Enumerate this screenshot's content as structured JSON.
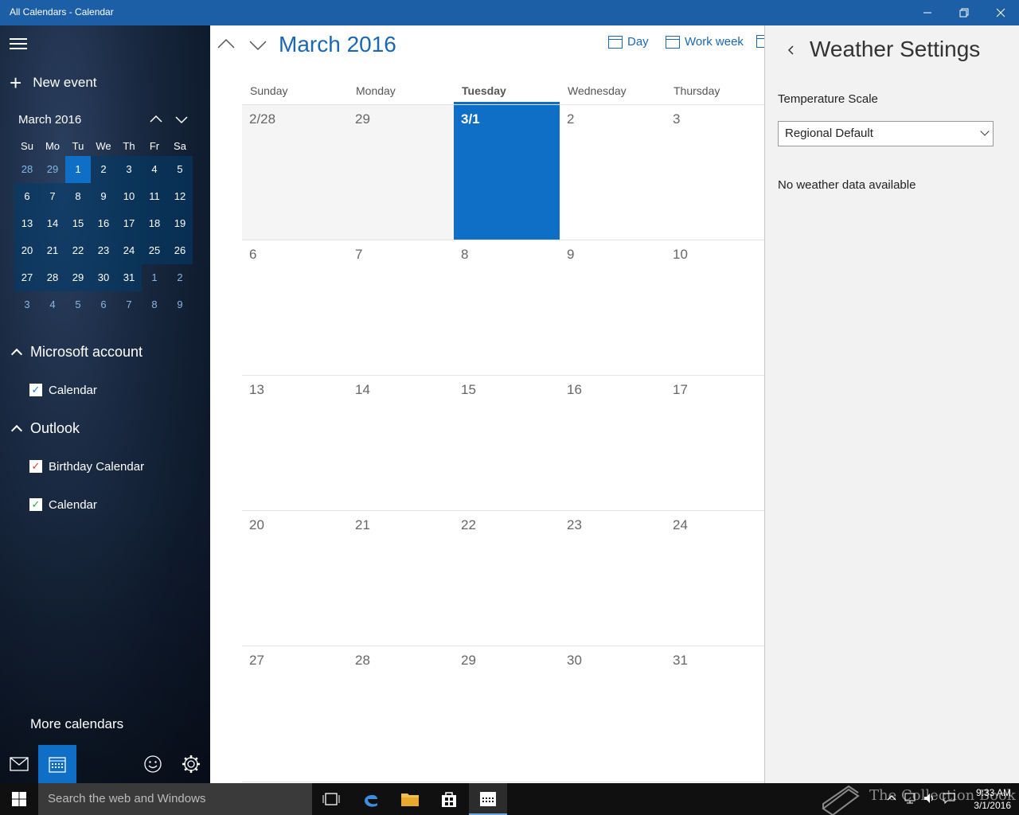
{
  "window": {
    "title": "All Calendars - Calendar"
  },
  "sidebar": {
    "new_event_label": "New event",
    "mini_calendar": {
      "month_label": "March 2016",
      "weekdays": [
        "Su",
        "Mo",
        "Tu",
        "We",
        "Th",
        "Fr",
        "Sa"
      ],
      "weeks": [
        [
          "28",
          "29",
          "1",
          "2",
          "3",
          "4",
          "5"
        ],
        [
          "6",
          "7",
          "8",
          "9",
          "10",
          "11",
          "12"
        ],
        [
          "13",
          "14",
          "15",
          "16",
          "17",
          "18",
          "19"
        ],
        [
          "20",
          "21",
          "22",
          "23",
          "24",
          "25",
          "26"
        ],
        [
          "27",
          "28",
          "29",
          "30",
          "31",
          "1",
          "2"
        ],
        [
          "3",
          "4",
          "5",
          "6",
          "7",
          "8",
          "9"
        ]
      ],
      "selected_day": "1"
    },
    "accounts": [
      {
        "name": "Microsoft account",
        "calendars": [
          {
            "label": "Calendar",
            "checked": true,
            "color": "#1a73d8"
          }
        ]
      },
      {
        "name": "Outlook",
        "calendars": [
          {
            "label": "Birthday Calendar",
            "checked": true,
            "color": "#d83b2b"
          },
          {
            "label": "Calendar",
            "checked": true,
            "color": "#2e9e44"
          }
        ]
      }
    ],
    "more_calendars_label": "More calendars"
  },
  "calendar": {
    "month_title": "March 2016",
    "views": {
      "day": "Day",
      "work_week": "Work week"
    },
    "weekdays": [
      "Sunday",
      "Monday",
      "Tuesday",
      "Wednesday",
      "Thursday"
    ],
    "today_weekday": "Tuesday",
    "weeks": [
      [
        "2/28",
        "29",
        "3/1",
        "2",
        "3"
      ],
      [
        "6",
        "7",
        "8",
        "9",
        "10"
      ],
      [
        "13",
        "14",
        "15",
        "16",
        "17"
      ],
      [
        "20",
        "21",
        "22",
        "23",
        "24"
      ],
      [
        "27",
        "28",
        "29",
        "30",
        "31"
      ]
    ],
    "today_label": "3/1",
    "accent": "#0f6fc6"
  },
  "weather_panel": {
    "title": "Weather Settings",
    "temperature_label": "Temperature Scale",
    "temperature_value": "Regional Default",
    "message": "No weather data available"
  },
  "taskbar": {
    "search_placeholder": "Search the web and Windows",
    "watermark": "The Collection Book",
    "time": "9:33 AM",
    "date": "3/1/2016"
  }
}
